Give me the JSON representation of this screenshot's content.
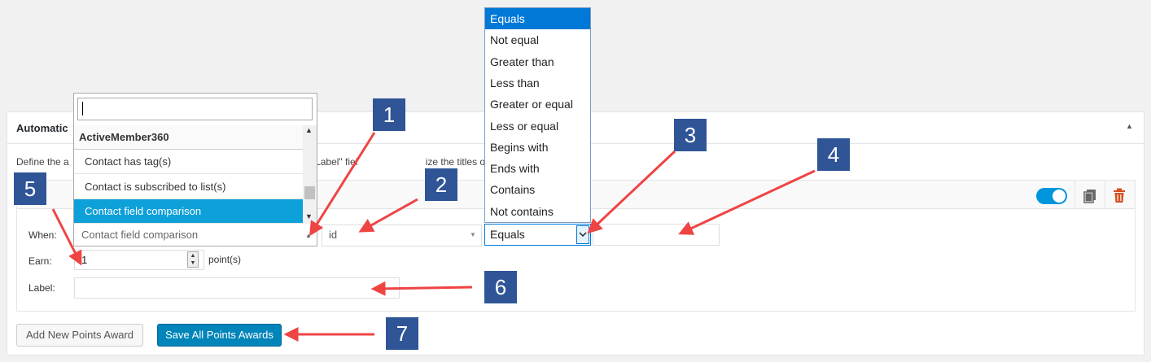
{
  "panel": {
    "title": "Automatic",
    "description": "Define the a                                                  this points type. Use the \"Label\" fiel                         ize the titles of each one."
  },
  "award": {
    "when_label": "When:",
    "earn_label": "Earn:",
    "label_label": "Label:",
    "type_value": "Contact field comparison",
    "field_value": "id",
    "comparison_value": "Equals",
    "compare_value": "",
    "earn_value": "1",
    "earn_unit": "point(s)",
    "label_value": "",
    "enabled": true
  },
  "type_dropdown": {
    "search_value": "",
    "group": "ActiveMember360",
    "items": [
      "Contact has tag(s)",
      "Contact is subscribed to list(s)",
      "Contact field comparison"
    ],
    "selected": "Contact field comparison",
    "selected_color": "#0ea0d9"
  },
  "comparison_options": [
    "Equals",
    "Not equal",
    "Greater than",
    "Less than",
    "Greater or equal",
    "Less or equal",
    "Begins with",
    "Ends with",
    "Contains",
    "Not contains"
  ],
  "buttons": {
    "add": "Add New Points Award",
    "save": "Save All Points Awards"
  },
  "callouts": [
    "1",
    "2",
    "3",
    "4",
    "5",
    "6",
    "7"
  ],
  "colors": {
    "callout": "#2f5597",
    "arrow": "#ef4444",
    "primary": "#0085ba",
    "toggle": "#0096dd",
    "trash": "#d54e21"
  },
  "icons": [
    "collapse-up-icon",
    "copy-icon",
    "trash-icon",
    "dropdown-arrow-icon",
    "scroll-up-icon",
    "scroll-down-icon",
    "spinner-icon"
  ]
}
